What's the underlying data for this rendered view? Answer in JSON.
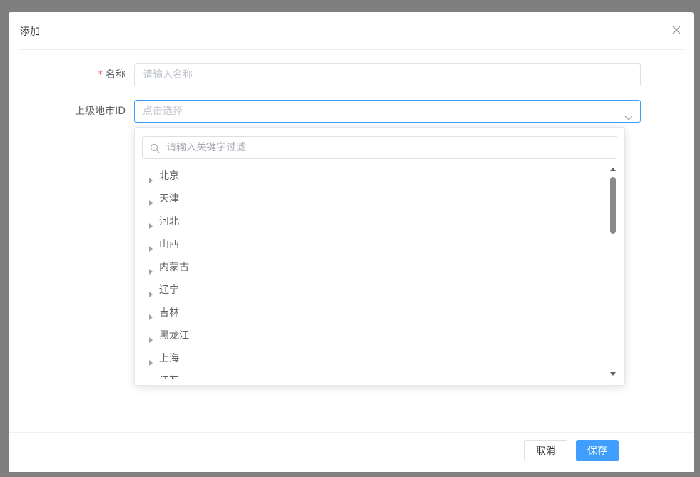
{
  "dialog": {
    "title": "添加"
  },
  "form": {
    "name": {
      "label": "名称",
      "required_mark": "*",
      "placeholder": "请输入名称"
    },
    "parent": {
      "label": "上级地市ID",
      "placeholder": "点击选择"
    }
  },
  "dropdown": {
    "filter_placeholder": "请输入关键字过滤",
    "nodes": [
      "北京",
      "天津",
      "河北",
      "山西",
      "内蒙古",
      "辽宁",
      "吉林",
      "黑龙江",
      "上海",
      "江苏"
    ]
  },
  "footer": {
    "cancel_label": "取消",
    "save_label": "保存"
  },
  "colors": {
    "primary": "#409eff",
    "required": "#f56c6c",
    "overlay": "#7f7f7f"
  }
}
